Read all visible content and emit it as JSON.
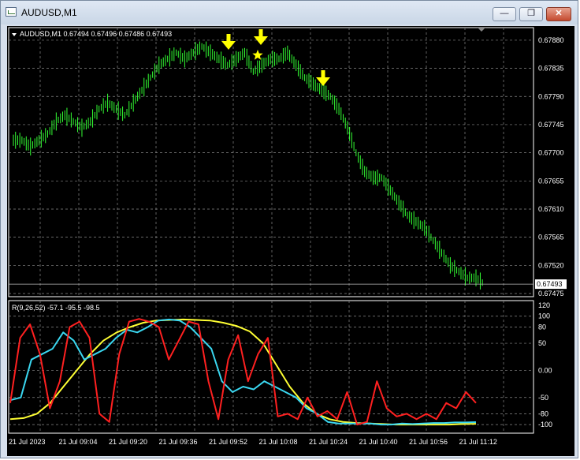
{
  "window": {
    "title": "AUDUSD,M1",
    "buttons": {
      "minimize": "—",
      "restore": "❐",
      "close": "✕"
    },
    "border_color": "#7a8ba0"
  },
  "main_panel": {
    "header": "AUDUSD,M1  0.67494 0.67496 0.67486 0.67493",
    "current_price_label": "0.67493",
    "price_ticks": [
      "0.67880",
      "0.67835",
      "0.67790",
      "0.67745",
      "0.67700",
      "0.67655",
      "0.67610",
      "0.67565",
      "0.67520",
      "0.67475"
    ],
    "candle_color": "#33ff33",
    "marker_color": "#ffff00",
    "arrow_icon": "arrow-down-icon",
    "star_icon": "star-icon"
  },
  "indicator_panel": {
    "header": "R(9,26,52) -57.1 -95.5 -98.5",
    "ticks": [
      "120",
      "100",
      "80",
      "50",
      "0.00",
      "-50",
      "-80",
      "-100"
    ],
    "series_colors": {
      "fast": "#ff2020",
      "mid": "#3ad7f0",
      "slow": "#ffff33"
    }
  },
  "time_axis": {
    "labels": [
      "21 Jul 2023",
      "21 Jul 09:04",
      "21 Jul 09:20",
      "21 Jul 09:36",
      "21 Jul 09:52",
      "21 Jul 10:08",
      "21 Jul 10:24",
      "21 Jul 10:40",
      "21 Jul 10:56",
      "21 Jul 11:12"
    ]
  },
  "chart_data": {
    "type": "line",
    "title": "AUDUSD,M1",
    "price": {
      "ylim": [
        0.67475,
        0.6789
      ],
      "x_labels": [
        "21 Jul 2023",
        "21 Jul 09:04",
        "21 Jul 09:20",
        "21 Jul 09:36",
        "21 Jul 09:52",
        "21 Jul 10:08",
        "21 Jul 10:24",
        "21 Jul 10:40",
        "21 Jul 10:56",
        "21 Jul 11:12"
      ],
      "closes": [
        0.6772,
        0.6771,
        0.6772,
        0.6773,
        0.6775,
        0.6776,
        0.6775,
        0.6774,
        0.6775,
        0.6777,
        0.6778,
        0.6777,
        0.6776,
        0.6778,
        0.678,
        0.6782,
        0.6784,
        0.6785,
        0.6786,
        0.6785,
        0.6786,
        0.6787,
        0.6786,
        0.6785,
        0.6784,
        0.6785,
        0.6786,
        0.6783,
        0.6784,
        0.6785,
        0.6785,
        0.6786,
        0.6784,
        0.6782,
        0.6781,
        0.678,
        0.6779,
        0.6777,
        0.6774,
        0.677,
        0.6767,
        0.6766,
        0.6766,
        0.6764,
        0.6762,
        0.676,
        0.6759,
        0.6758,
        0.6756,
        0.6754,
        0.6752,
        0.6751,
        0.675,
        0.675,
        0.6749
      ]
    },
    "indicator": {
      "name": "R(9,26,52)",
      "last_values": [
        -57.1,
        -95.5,
        -98.5
      ],
      "ylim": [
        -110,
        120
      ],
      "series": [
        {
          "name": "9",
          "color": "#ff2020",
          "values": [
            -60,
            60,
            85,
            30,
            -70,
            -20,
            80,
            90,
            60,
            -80,
            -95,
            30,
            90,
            95,
            90,
            80,
            20,
            55,
            90,
            85,
            -20,
            -90,
            20,
            65,
            -20,
            30,
            60,
            -85,
            -80,
            -90,
            -50,
            -85,
            -75,
            -90,
            -40,
            -100,
            -95,
            -20,
            -70,
            -85,
            -80,
            -90,
            -80,
            -90,
            -60,
            -70,
            -40,
            -60
          ]
        },
        {
          "name": "26",
          "color": "#3ad7f0",
          "values": [
            -55,
            -50,
            20,
            30,
            40,
            70,
            55,
            20,
            30,
            40,
            60,
            75,
            70,
            80,
            92,
            94,
            92,
            80,
            60,
            40,
            -20,
            -40,
            -30,
            -35,
            -20,
            -30,
            -40,
            -50,
            -70,
            -80,
            -95,
            -98,
            -98,
            -98,
            -98,
            -100,
            -100,
            -98,
            -99,
            -98,
            -97,
            -97,
            -96,
            -96,
            -95.5
          ]
        },
        {
          "name": "52",
          "color": "#ffff33",
          "values": [
            -90,
            -88,
            -80,
            -60,
            -30,
            0,
            30,
            55,
            70,
            80,
            88,
            92,
            93,
            94,
            93,
            92,
            88,
            82,
            72,
            50,
            10,
            -30,
            -60,
            -80,
            -90,
            -95,
            -97,
            -98,
            -99,
            -100,
            -100,
            -100,
            -100,
            -100,
            -99,
            -98.5
          ]
        }
      ]
    },
    "markers": [
      {
        "type": "arrow-down",
        "near": "21 Jul 09:52"
      },
      {
        "type": "arrow-down",
        "near": "21 Jul 10:08"
      },
      {
        "type": "star",
        "near": "21 Jul 10:08"
      },
      {
        "type": "arrow-down",
        "near": "21 Jul 10:24"
      }
    ],
    "grid": true
  }
}
